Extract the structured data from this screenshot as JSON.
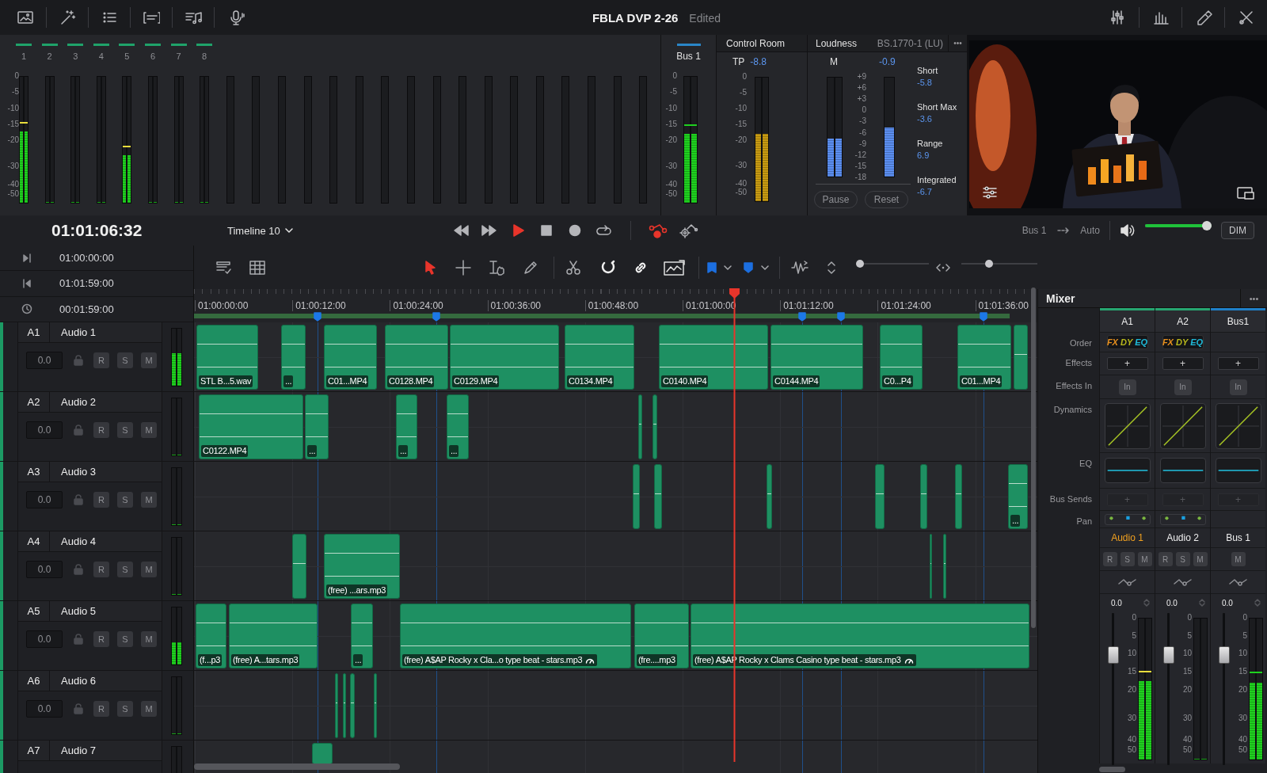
{
  "topbar": {
    "title": "FBLA DVP 2-26",
    "status": "Edited"
  },
  "meters": {
    "scale": [
      "0",
      "-5",
      "-10",
      "-15",
      "-20",
      "-30",
      "-40",
      "-50"
    ],
    "channels": [
      {
        "label": "1",
        "level": 0.56
      },
      {
        "label": "2",
        "level": 0
      },
      {
        "label": "3",
        "level": 0
      },
      {
        "label": "4",
        "level": 0
      },
      {
        "label": "5",
        "level": 0.37
      },
      {
        "label": "6",
        "level": 0
      },
      {
        "label": "7",
        "level": 0
      },
      {
        "label": "8",
        "level": 0
      }
    ]
  },
  "bus": {
    "label": "Bus 1",
    "scale": [
      "0",
      "-5",
      "-10",
      "-15",
      "-20",
      "-30",
      "-40",
      "-50"
    ],
    "level": 0.54
  },
  "control_room": {
    "title": "Control Room",
    "tp_label": "TP",
    "tp_value": "-8.8",
    "scale": [
      "0",
      "-5",
      "-10",
      "-15",
      "-20",
      "-30",
      "-40",
      "-50"
    ],
    "level": 0.54
  },
  "loudness": {
    "title": "Loudness",
    "standard": "BS.1770-1 (LU)",
    "menu": "•••",
    "m_label": "M",
    "m_value": "-0.9",
    "scale": [
      "+9",
      "+6",
      "+3",
      "0",
      "-3",
      "-6",
      "-9",
      "-12",
      "-15",
      "-18"
    ],
    "m_meter": {
      "level": 0.38
    },
    "value_meter": {
      "level": 0.49
    },
    "stats": [
      {
        "label": "Short",
        "value": "-5.8"
      },
      {
        "label": "Short Max",
        "value": "-3.6"
      },
      {
        "label": "Range",
        "value": "6.9"
      },
      {
        "label": "Integrated",
        "value": "-6.7"
      }
    ],
    "buttons": [
      "Pause",
      "Reset"
    ]
  },
  "transport": {
    "timecode": "01:01:06:32",
    "timeline": "Timeline 10",
    "output": "Bus 1",
    "automation": "Auto",
    "volume": {
      "level": 1
    },
    "dim": "DIM"
  },
  "time_info": [
    {
      "kind": "in",
      "value": "01:00:00:00"
    },
    {
      "kind": "out",
      "value": "01:01:59:00"
    },
    {
      "kind": "duration",
      "value": "00:01:59:00"
    }
  ],
  "toolbar": {
    "edit_tools": [
      {
        "selected": true
      },
      {
        "selected": false
      },
      {
        "selected": false
      },
      {
        "selected": false
      }
    ],
    "zoom_slider": {
      "level": 0
    },
    "height_slider": {
      "level": 0.35
    }
  },
  "ruler": {
    "ticks": [
      "01:00:00:00",
      "01:00:12:00",
      "01:00:24:00",
      "01:00:36:00",
      "01:00:48:00",
      "01:01:00:00",
      "01:01:12:00",
      "01:01:24:00",
      "01:01:36:00"
    ]
  },
  "tracks": [
    {
      "id": "A1",
      "name": "Audio 1",
      "volume": "0.0",
      "buttons": [
        "R",
        "S",
        "M"
      ],
      "level": 0.56,
      "clips": [
        {
          "kind": "clip",
          "label": "STL B...5.wav"
        },
        {
          "kind": "clip",
          "label": "..."
        },
        {
          "kind": "clip",
          "label": "C01...MP4"
        },
        {
          "kind": "clip",
          "label": "C0128.MP4"
        },
        {
          "kind": "clip",
          "label": "C0129.MP4"
        },
        {
          "kind": "clip",
          "label": "C0134.MP4"
        },
        {
          "kind": "clip",
          "label": "C0140.MP4"
        },
        {
          "kind": "clip",
          "label": "C0144.MP4"
        },
        {
          "kind": "clip",
          "label": "C0...P4"
        },
        {
          "kind": "clip",
          "label": "C01...MP4"
        },
        {
          "kind": "sliver"
        }
      ]
    },
    {
      "id": "A2",
      "name": "Audio 2",
      "volume": "0.0",
      "buttons": [
        "R",
        "S",
        "M"
      ],
      "level": 0,
      "clips": [
        {
          "kind": "clip",
          "label": "C0122.MP4"
        },
        {
          "kind": "clip",
          "label": "..."
        },
        {
          "kind": "clip",
          "label": "..."
        },
        {
          "kind": "clip",
          "label": "..."
        },
        {
          "kind": "sliver"
        },
        {
          "kind": "sliver"
        }
      ]
    },
    {
      "id": "A3",
      "name": "Audio 3",
      "volume": "0.0",
      "buttons": [
        "R",
        "S",
        "M"
      ],
      "level": 0,
      "clips": [
        {
          "kind": "sliver"
        },
        {
          "kind": "sliver"
        },
        {
          "kind": "sliver"
        },
        {
          "kind": "sliver"
        },
        {
          "kind": "sliver"
        },
        {
          "kind": "sliver"
        },
        {
          "kind": "clip",
          "label": "..."
        }
      ]
    },
    {
      "id": "A4",
      "name": "Audio 4",
      "volume": "0.0",
      "buttons": [
        "R",
        "S",
        "M"
      ],
      "level": 0,
      "clips": [
        {
          "kind": "sliver"
        },
        {
          "kind": "clip",
          "label": "(free) ...ars.mp3"
        },
        {
          "kind": "sliver"
        },
        {
          "kind": "sliver"
        }
      ]
    },
    {
      "id": "A5",
      "name": "Audio 5",
      "volume": "0.0",
      "buttons": [
        "R",
        "S",
        "M"
      ],
      "level": 0.37,
      "clips": [
        {
          "kind": "clip",
          "label": "(f...p3"
        },
        {
          "kind": "clip",
          "label": "(free) A...tars.mp3"
        },
        {
          "kind": "clip",
          "label": "..."
        },
        {
          "kind": "clip",
          "label": "(free) A$AP Rocky x Cla...o type beat - stars.mp3",
          "retimed": true
        },
        {
          "kind": "clip",
          "label": "(fre....mp3"
        },
        {
          "kind": "clip",
          "label": "(free) A$AP Rocky x Clams Casino type beat - stars.mp3",
          "retimed": true
        }
      ]
    },
    {
      "id": "A6",
      "name": "Audio 6",
      "volume": "0.0",
      "buttons": [
        "R",
        "S",
        "M"
      ],
      "level": 0,
      "clips": [
        {
          "kind": "sliver"
        },
        {
          "kind": "sliver"
        },
        {
          "kind": "sliver"
        },
        {
          "kind": "sliver"
        }
      ]
    },
    {
      "id": "A7",
      "name": "Audio 7",
      "clips": [
        {
          "kind": "sliver"
        }
      ]
    }
  ],
  "mixer": {
    "title": "Mixer",
    "menu": "•••",
    "row_labels": [
      "Order",
      "Effects",
      "Effects In",
      "Dynamics",
      "EQ",
      "Bus Sends",
      "Pan"
    ],
    "channels": [
      {
        "id": "A1",
        "kind": "track",
        "color": "#27a571",
        "order": [
          "FX",
          "DY",
          "EQ"
        ],
        "effects": "+",
        "effects_in": "In",
        "bus_sends": "+",
        "name": "Audio 1",
        "selected": true,
        "buttons": [
          "R",
          "S",
          "M"
        ],
        "value": "0.0",
        "scale": [
          "0",
          "5",
          "10",
          "15",
          "20",
          "30",
          "40",
          "50"
        ],
        "fader": {
          "level": 0.74
        },
        "meter": {
          "level": 0.55
        }
      },
      {
        "id": "A2",
        "kind": "track",
        "color": "#27a571",
        "order": [
          "FX",
          "DY",
          "EQ"
        ],
        "effects": "+",
        "effects_in": "In",
        "bus_sends": "+",
        "name": "Audio 2",
        "selected": false,
        "buttons": [
          "R",
          "S",
          "M"
        ],
        "value": "0.0",
        "scale": [
          "0",
          "5",
          "10",
          "15",
          "20",
          "30",
          "40",
          "50"
        ],
        "fader": {
          "level": 0.74
        },
        "meter": {
          "level": 0
        }
      },
      {
        "id": "Bus1",
        "kind": "bus",
        "color": "#1f80c8",
        "effects": "+",
        "effects_in": "In",
        "bus_sends": "+",
        "name": "Bus 1",
        "selected": false,
        "buttons": [
          "M"
        ],
        "value": "0.0",
        "scale": [
          "0",
          "5",
          "10",
          "15",
          "20",
          "30",
          "40",
          "50"
        ],
        "fader": {
          "level": 0.74
        },
        "meter": {
          "level": 0.54
        }
      }
    ]
  }
}
